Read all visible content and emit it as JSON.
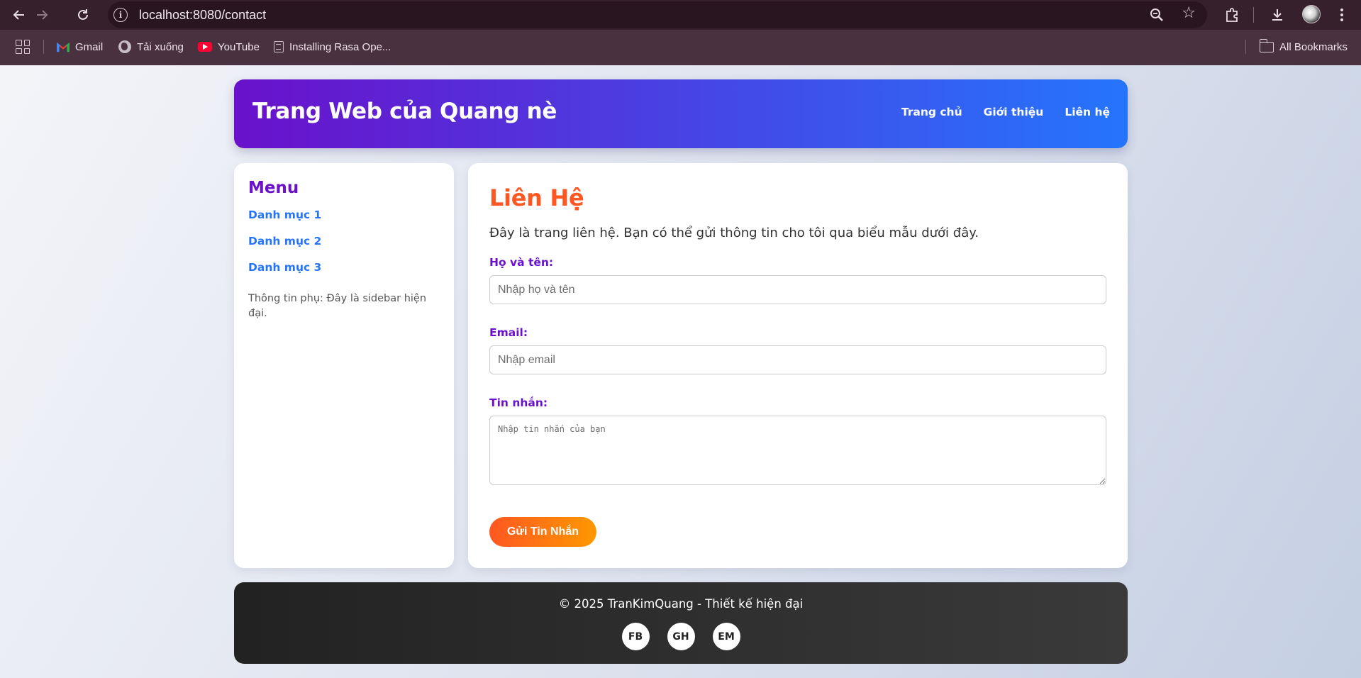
{
  "browser": {
    "url": "localhost:8080/contact",
    "bookmarks": [
      {
        "label": "Gmail",
        "icon": "gmail-icon"
      },
      {
        "label": "Tải xuống",
        "icon": "globe-icon"
      },
      {
        "label": "YouTube",
        "icon": "youtube-icon"
      },
      {
        "label": "Installing Rasa Ope...",
        "icon": "document-icon"
      }
    ],
    "all_bookmarks_label": "All Bookmarks"
  },
  "header": {
    "title": "Trang Web của Quang nè",
    "nav": [
      "Trang chủ",
      "Giới thiệu",
      "Liên hệ"
    ]
  },
  "sidebar": {
    "title": "Menu",
    "items": [
      "Danh mục 1",
      "Danh mục 2",
      "Danh mục 3"
    ],
    "note": "Thông tin phụ: Đây là sidebar hiện đại."
  },
  "main": {
    "heading": "Liên Hệ",
    "intro": "Đây là trang liên hệ. Bạn có thể gửi thông tin cho tôi qua biểu mẫu dưới đây.",
    "fields": {
      "name": {
        "label": "Họ và tên:",
        "placeholder": "Nhập họ và tên",
        "value": ""
      },
      "email": {
        "label": "Email:",
        "placeholder": "Nhập email",
        "value": ""
      },
      "message": {
        "label": "Tin nhắn:",
        "placeholder": "Nhập tin nhắn của bạn",
        "value": ""
      }
    },
    "submit_label": "Gửi Tin Nhắn"
  },
  "footer": {
    "copyright": "© 2025 TranKimQuang - Thiết kế hiện đại",
    "socials": [
      "FB",
      "GH",
      "EM"
    ]
  },
  "colors": {
    "header_gradient": [
      "#6a11cb",
      "#2575fc"
    ],
    "accent_orange": "#ff5722",
    "accent_purple": "#6a11cb",
    "link_blue": "#2575fc",
    "footer_bg": "#2a2a2a"
  }
}
